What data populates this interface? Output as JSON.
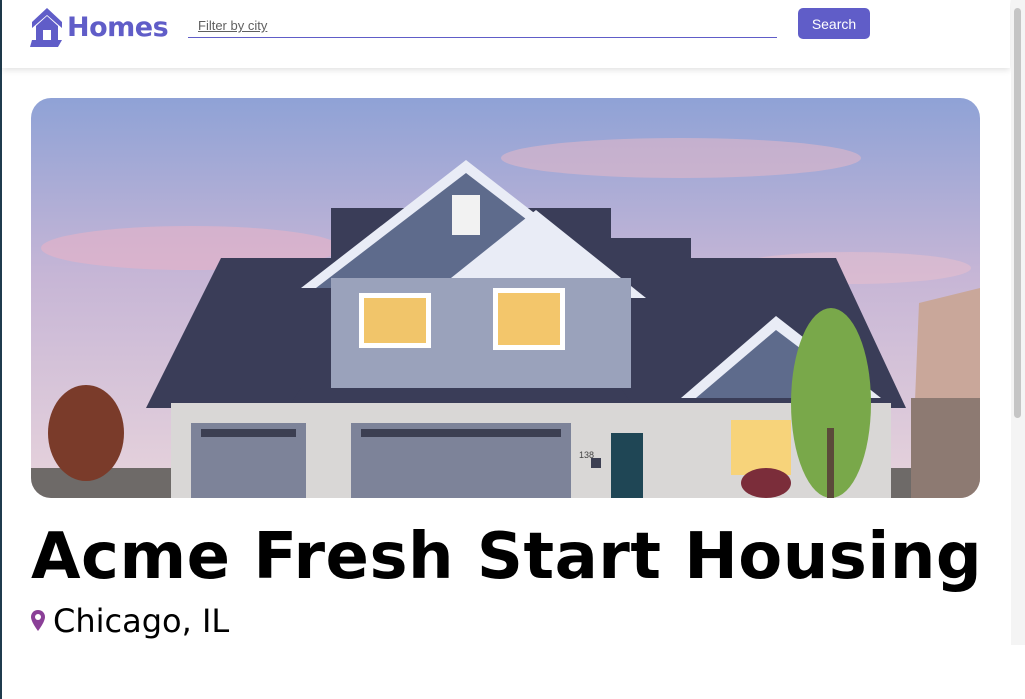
{
  "brand": {
    "name": "Homes",
    "color": "#605dc8"
  },
  "search": {
    "placeholder": "Filter by city",
    "button_label": "Search"
  },
  "listing": {
    "title": "Acme Fresh Start Housing",
    "location": "Chicago, IL",
    "image_icon": "house-photo",
    "house_number": "138"
  },
  "icons": {
    "logo": "house-icon",
    "location": "map-pin-icon"
  }
}
